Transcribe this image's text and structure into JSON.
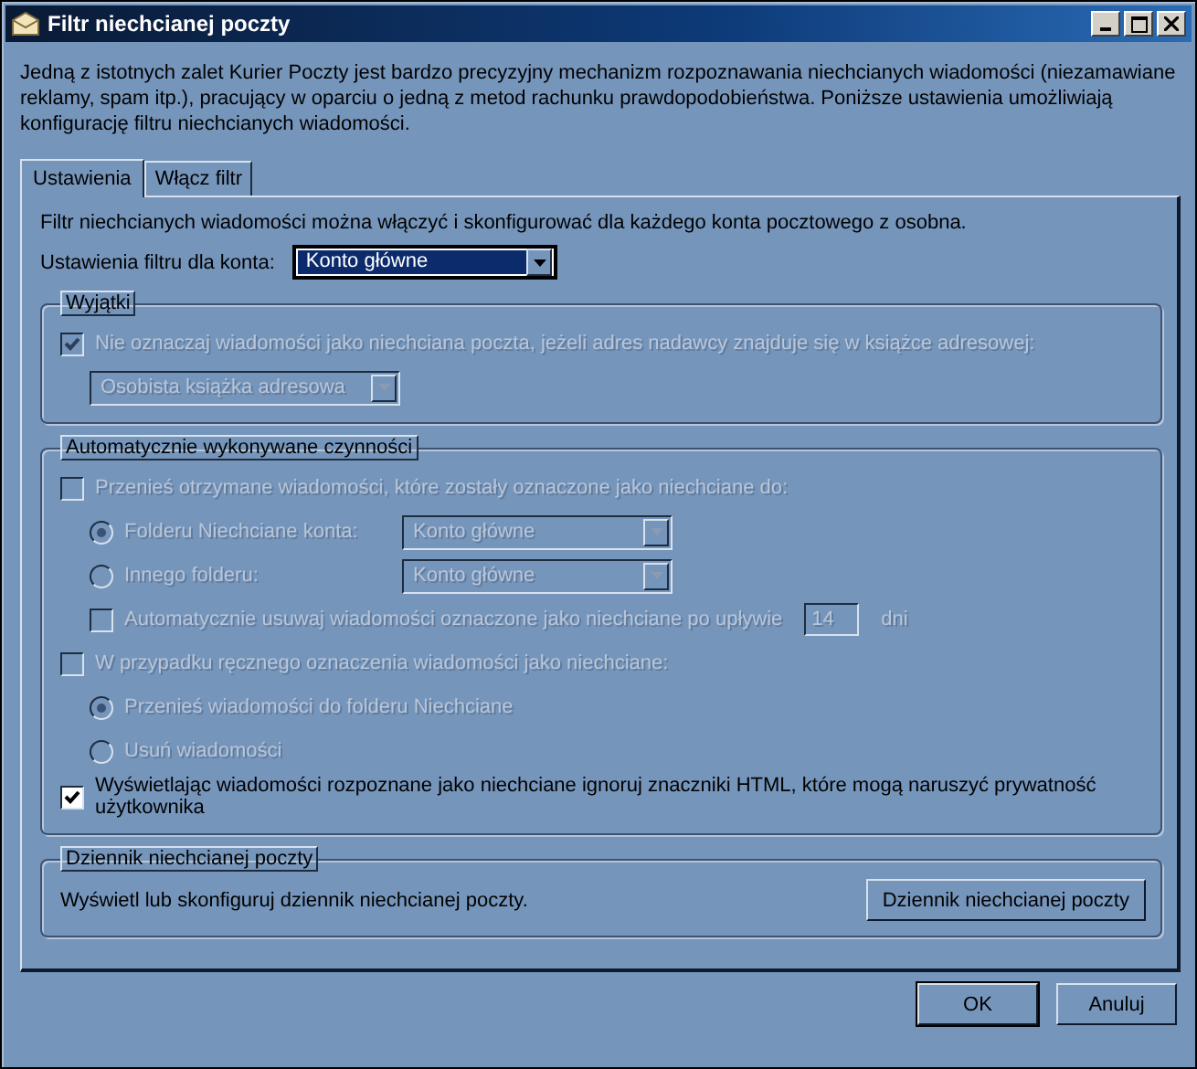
{
  "window": {
    "title": "Filtr niechcianej poczty"
  },
  "intro": "Jedną z istotnych zalet Kurier Poczty jest bardzo precyzyjny mechanizm rozpoznawania niechcianych wiadomości (niezamawiane reklamy, spam itp.), pracujący w oparciu o jedną z metod rachunku prawdopodobieństwa. Poniższe ustawienia umożliwiają konfigurację filtru niechcianych wiadomości.",
  "tabs": [
    {
      "label": "Ustawienia",
      "selected": true
    },
    {
      "label": "Włącz filtr",
      "selected": false
    }
  ],
  "tab_intro": "Filtr niechcianych wiadomości można włączyć i skonfigurować dla każdego konta pocztowego z osobna.",
  "account": {
    "label": "Ustawienia filtru dla konta:",
    "value": "Konto główne"
  },
  "groups": [
    {
      "title": "Wyjątki",
      "items": [
        {
          "kind": "checkbox",
          "label": "Nie oznaczaj wiadomości jako niechciana poczta, jeżeli adres nadawcy znajduje się w książce adresowej:",
          "checked": true,
          "disabled": true,
          "children": [
            {
              "kind": "select",
              "value": "Osobista książka adresowa",
              "disabled": true
            }
          ]
        }
      ]
    },
    {
      "title": "Automatycznie wykonywane czynności",
      "items": [
        {
          "kind": "checkbox",
          "label": "Przenieś otrzymane wiadomości, które zostały oznaczone jako niechciane do:",
          "checked": false,
          "disabled": true,
          "children": [
            {
              "kind": "radio_select",
              "label": "Folderu Niechciane konta:",
              "selected": true,
              "disabled": true,
              "value": "Konto główne"
            },
            {
              "kind": "radio_select",
              "label": "Innego folderu:",
              "selected": false,
              "disabled": true,
              "value": "Konto główne"
            },
            {
              "kind": "days",
              "label": "Automatycznie usuwaj wiadomości oznaczone jako niechciane po upływie",
              "checked": false,
              "disabled": true,
              "value": "14",
              "unit": "dni"
            }
          ]
        },
        {
          "kind": "checkbox",
          "label": "W przypadku ręcznego oznaczenia wiadomości jako niechciane:",
          "checked": false,
          "disabled": true,
          "children": [
            {
              "kind": "radio",
              "label": "Przenieś wiadomości do folderu Niechciane",
              "selected": true,
              "disabled": true
            },
            {
              "kind": "radio",
              "label": "Usuń wiadomości",
              "selected": false,
              "disabled": true
            }
          ]
        },
        {
          "kind": "checkbox",
          "label": "Wyświetlając wiadomości rozpoznane jako niechciane ignoruj znaczniki HTML, które mogą naruszyć prywatność użytkownika",
          "checked": true,
          "disabled": false
        }
      ]
    },
    {
      "title": "Dziennik niechcianej poczty",
      "items": [
        {
          "kind": "text_button",
          "label": "Wyświetl lub skonfiguruj dziennik niechcianej poczty.",
          "button": "Dziennik niechcianej poczty"
        }
      ]
    }
  ],
  "buttons": [
    {
      "label": "OK",
      "default": true
    },
    {
      "label": "Anuluj",
      "default": false
    }
  ]
}
